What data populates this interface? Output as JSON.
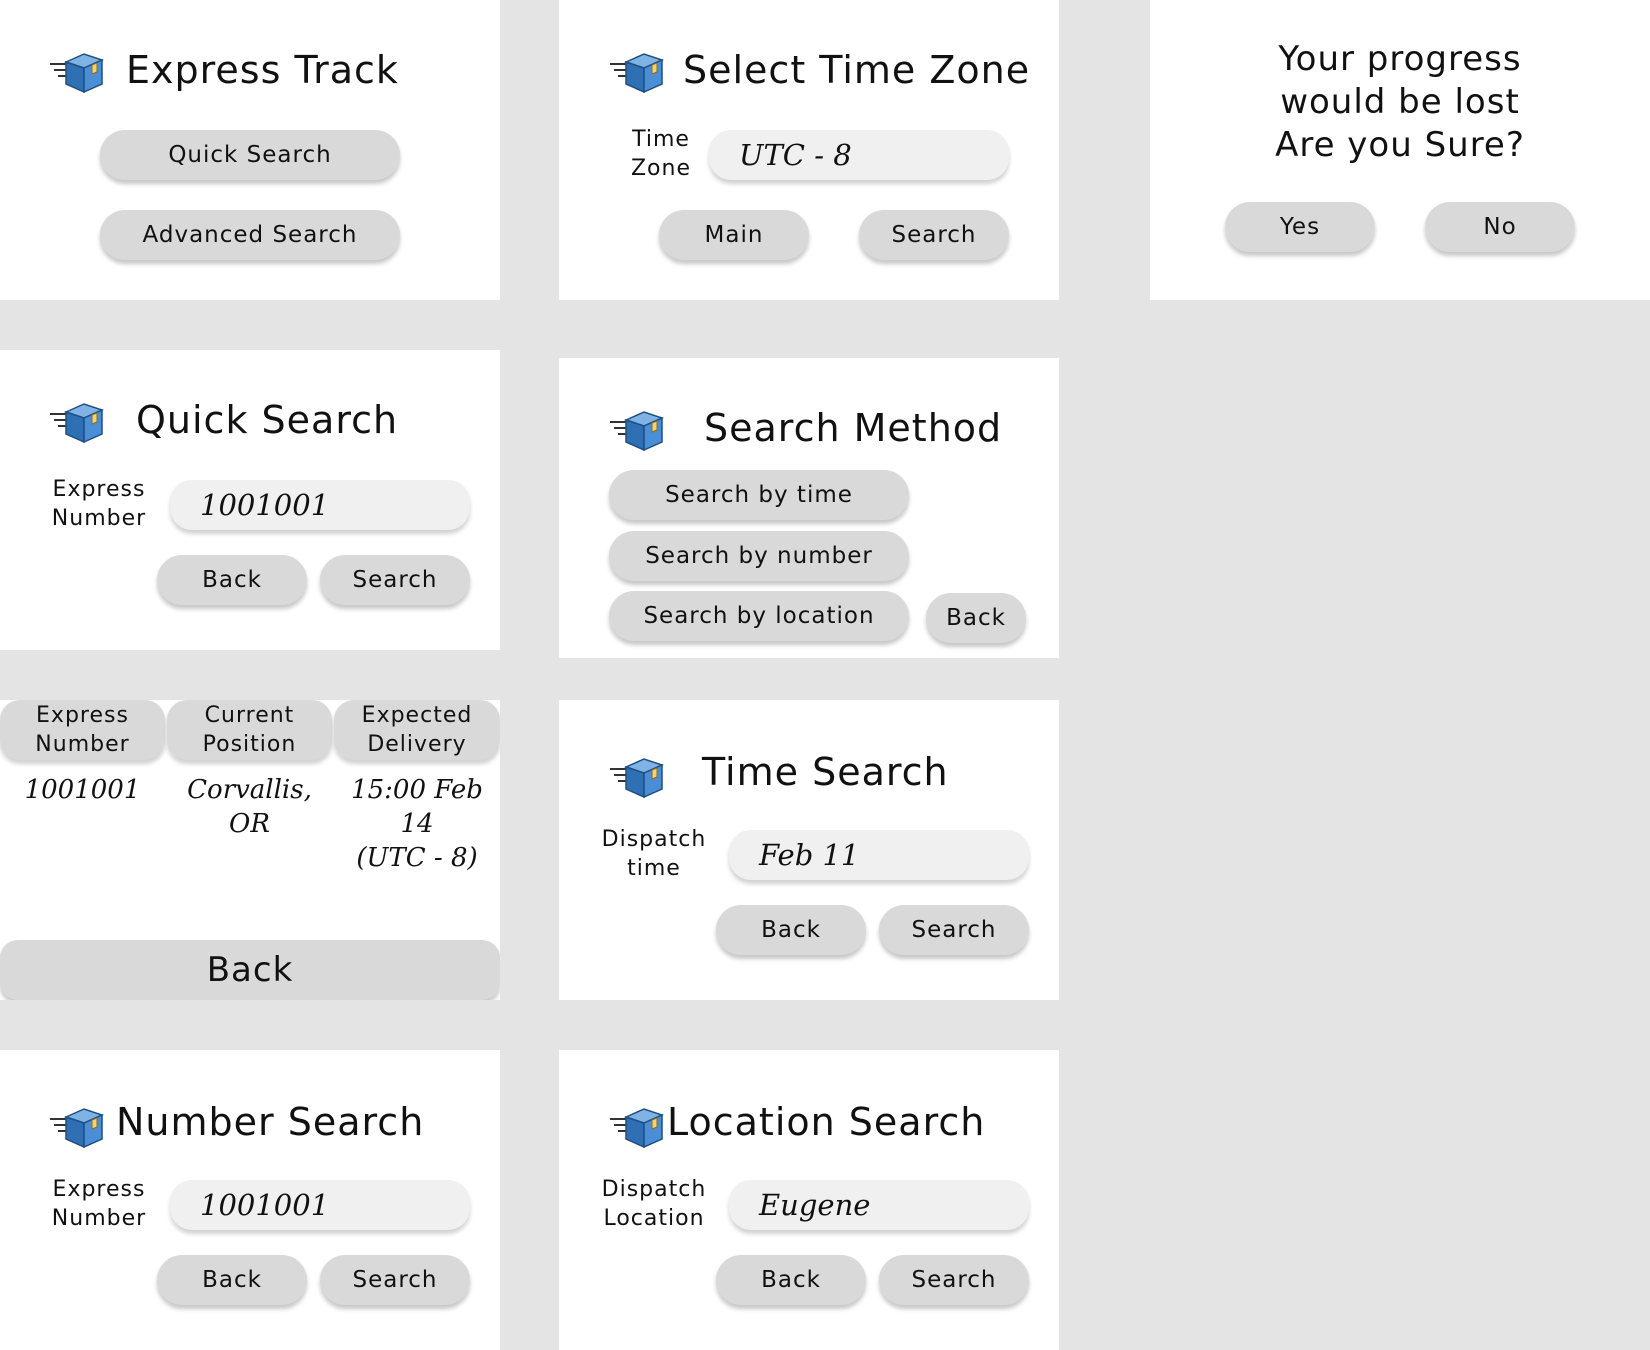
{
  "colors": {
    "background": "#e4e4e4",
    "panel": "#ffffff",
    "button": "#d9d9d9",
    "field": "#f0f0f0",
    "box_blue": "#3d7fc4"
  },
  "logo_icon": "package-box-icon",
  "express_track": {
    "title": "Express Track",
    "quick_search": "Quick Search",
    "advanced_search": "Advanced Search"
  },
  "time_zone": {
    "title": "Select Time Zone",
    "label": "Time\nZone",
    "value": "UTC - 8",
    "main": "Main",
    "search": "Search"
  },
  "confirm": {
    "message": "Your progress\nwould be lost\nAre you Sure?",
    "yes": "Yes",
    "no": "No"
  },
  "quick_search": {
    "title": "Quick Search",
    "label": "Express\nNumber",
    "value": "1001001",
    "back": "Back",
    "search": "Search"
  },
  "search_method": {
    "title": "Search Method",
    "by_time": "Search by time",
    "by_number": "Search by number",
    "by_location": "Search by location",
    "back": "Back"
  },
  "results": {
    "headers": [
      "Express\nNumber",
      "Current\nPosition",
      "Expected\nDelivery"
    ],
    "row": [
      "1001001",
      "Corvallis,\nOR",
      "15:00 Feb 14\n(UTC - 8)"
    ],
    "back": "Back"
  },
  "time_search": {
    "title": "Time Search",
    "label": "Dispatch\ntime",
    "value": "Feb 11",
    "back": "Back",
    "search": "Search"
  },
  "number_search": {
    "title": "Number Search",
    "label": "Express\nNumber",
    "value": "1001001",
    "back": "Back",
    "search": "Search"
  },
  "location_search": {
    "title": "Location Search",
    "label": "Dispatch\nLocation",
    "value": "Eugene",
    "back": "Back",
    "search": "Search"
  }
}
